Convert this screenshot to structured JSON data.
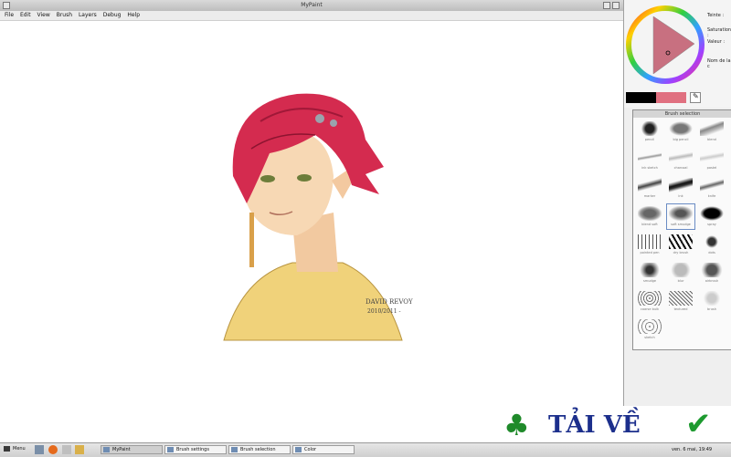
{
  "window": {
    "title": "MyPaint"
  },
  "menu": [
    "File",
    "Edit",
    "View",
    "Brush",
    "Layers",
    "Debug",
    "Help"
  ],
  "artwork": {
    "signature_line1": "DAVID REVOY",
    "signature_line2": "2010/2011 -"
  },
  "color_panel": {
    "labels": {
      "hue": "Teinte :",
      "saturation": "Saturation :",
      "value": "Valeur :",
      "name": "Nom de la c"
    },
    "current_color": "#e07080",
    "previous_color": "#000000"
  },
  "brush_window": {
    "title": "Brush selection",
    "brushes": [
      "pencil",
      "big pencil",
      "blend",
      "ink sketch",
      "charcoal",
      "pastel",
      "marker",
      "ink",
      "knife",
      "blend soft",
      "soft smudge",
      "spray",
      "pointed pen",
      "dry brush",
      "dots",
      "smudge",
      "blur",
      "airbrush",
      "coarse bulk",
      "textured",
      "brush",
      "sketch"
    ]
  },
  "taskbar": {
    "menu_label": "Menu",
    "tasks": [
      "MyPaint",
      "Brush settings",
      "Brush selection",
      "Color"
    ],
    "clock": "ven. 6 mai, 19:49"
  },
  "watermark": {
    "text": "TẢI VỀ"
  }
}
